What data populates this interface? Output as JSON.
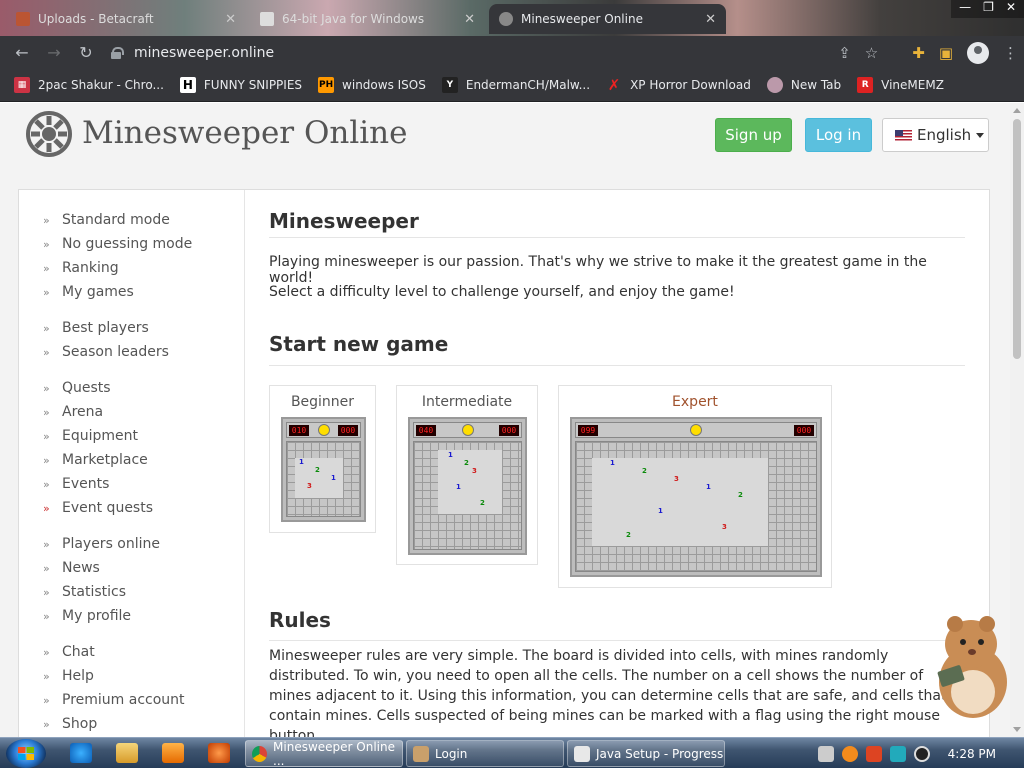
{
  "browser": {
    "tabs": [
      {
        "title": "Uploads - Betacraft"
      },
      {
        "title": "64-bit Java for Windows"
      },
      {
        "title": "Minesweeper Online",
        "active": true
      }
    ],
    "url": "minesweeper.online",
    "bookmarks": [
      {
        "label": "2pac Shakur - Chro...",
        "icon": "calendar-icon"
      },
      {
        "label": "FUNNY SNIPPIES",
        "icon": "h-logo-icon"
      },
      {
        "label": "windows ISOS",
        "icon": "ph-logo-icon"
      },
      {
        "label": "EndermanCH/Malw...",
        "icon": "yp-logo-icon"
      },
      {
        "label": "XP Horror Download",
        "icon": "x-logo-icon"
      },
      {
        "label": "New Tab",
        "icon": "globe-icon"
      },
      {
        "label": "VineMEMZ",
        "icon": "r-logo-icon"
      }
    ]
  },
  "site": {
    "brand": "Minesweeper Online",
    "signup": "Sign up",
    "login": "Log in",
    "language": "English"
  },
  "sidebar": {
    "groups": [
      [
        "Standard mode",
        "No guessing mode",
        "Ranking",
        "My games"
      ],
      [
        "Best players",
        "Season leaders"
      ],
      [
        "Quests",
        "Arena",
        "Equipment",
        "Marketplace",
        "Events",
        "Event quests"
      ],
      [
        "Players online",
        "News",
        "Statistics",
        "My profile"
      ],
      [
        "Chat",
        "Help",
        "Premium account",
        "Shop"
      ]
    ]
  },
  "main": {
    "title": "Minesweeper",
    "intro1": "Playing minesweeper is our passion. That's why we strive to make it the greatest game in the world!",
    "intro2": "Select a difficulty level to challenge yourself, and enjoy the game!",
    "start_title": "Start new game",
    "levels": [
      {
        "name": "Beginner",
        "left_counter": "010",
        "right_counter": "000"
      },
      {
        "name": "Intermediate",
        "left_counter": "040",
        "right_counter": "000"
      },
      {
        "name": "Expert",
        "left_counter": "099",
        "right_counter": "000"
      }
    ],
    "rules_title": "Rules",
    "rules_text": "Minesweeper rules are very simple. The board is divided into cells, with mines randomly distributed. To win, you need to open all the cells. The number on a cell shows the number of mines adjacent to it. Using this information, you can determine cells that are safe, and cells that contain mines. Cells suspected of being mines can be marked with a flag using the right mouse button."
  },
  "taskbar": {
    "buttons": [
      {
        "label": "Minesweeper Online ...",
        "active": true
      },
      {
        "label": "Login"
      },
      {
        "label": "Java Setup - Progress"
      }
    ],
    "clock": "4:28 PM"
  },
  "colors": {
    "signup": "#5cb85c",
    "login": "#5bc0de",
    "chrome_bar": "#35363a",
    "page_bg": "#f3f3f3"
  }
}
